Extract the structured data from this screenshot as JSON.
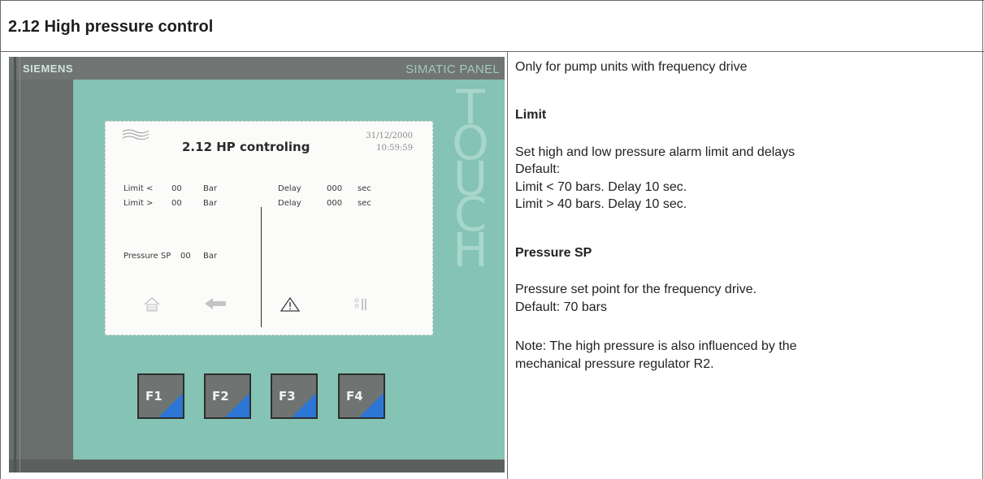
{
  "section": {
    "title": "2.12 High pressure control"
  },
  "panel": {
    "brand": "SIEMENS",
    "model": "SIMATIC PANEL",
    "touch": [
      "T",
      "O",
      "U",
      "C",
      "H"
    ],
    "screen": {
      "title": "2.12 HP controling",
      "date": "31/12/2000",
      "time": "10:59:59",
      "rows": [
        {
          "label": "Limit <",
          "value": "00",
          "unit": "Bar",
          "delay_label": "Delay",
          "delay_value": "000",
          "delay_unit": "sec"
        },
        {
          "label": "Limit >",
          "value": "00",
          "unit": "Bar",
          "delay_label": "Delay",
          "delay_value": "000",
          "delay_unit": "sec"
        }
      ],
      "pressure_sp": {
        "label": "Pressure SP",
        "value": "00",
        "unit": "Bar"
      },
      "nav_icons": [
        "home-icon",
        "back-arrow-icon",
        "alarm-triangle-icon",
        "settings-slider-icon"
      ]
    },
    "function_keys": [
      "F1",
      "F2",
      "F3",
      "F4"
    ],
    "colors": {
      "bezel": "#686e6c",
      "face": "#85c3b4",
      "key_accent": "#2d76d6"
    }
  },
  "description": {
    "intro": "Only for pump units with frequency drive",
    "limit_heading": "Limit",
    "limit_text": "Set high and low pressure alarm limit and delays",
    "default_label": "Default:",
    "default_low": "Limit < 70 bars. Delay 10 sec.",
    "default_high": "Limit > 40 bars. Delay 10 sec.",
    "sp_heading": "Pressure SP",
    "sp_text": "Pressure set point for the frequency drive.",
    "sp_default": "Default: 70 bars",
    "note_line1": "Note: The high pressure is also influenced by the",
    "note_line2": "mechanical pressure regulator R2."
  }
}
